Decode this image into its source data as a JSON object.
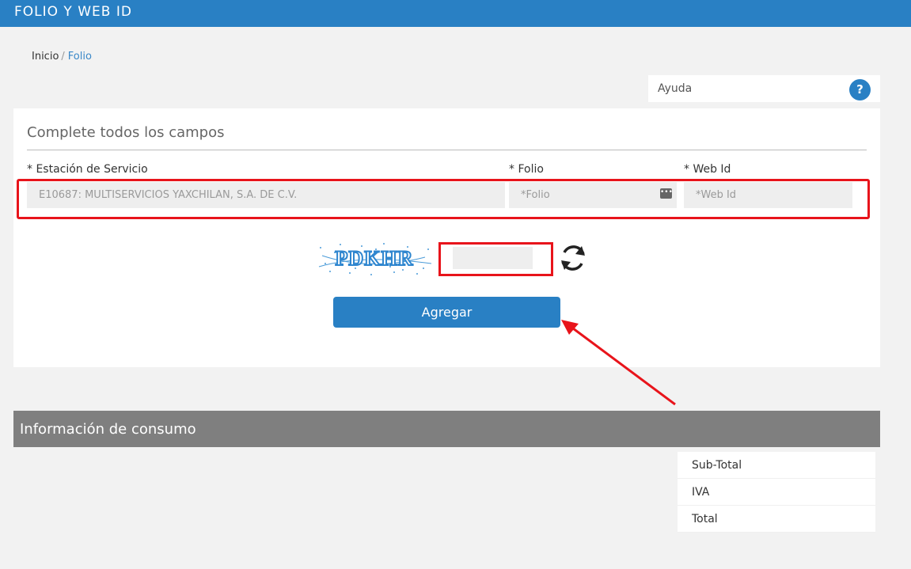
{
  "header": {
    "title": "FOLIO Y WEB ID",
    "bg_color": "#2980c4"
  },
  "breadcrumb": {
    "home": "Inicio",
    "separator": "/",
    "current": "Folio"
  },
  "help": {
    "label": "Ayuda",
    "icon": "?"
  },
  "form": {
    "heading": "Complete todos los campos",
    "station": {
      "label": "* Estación de Servicio",
      "value": "E10687: MULTISERVICIOS YAXCHILAN, S.A. DE C.V."
    },
    "folio": {
      "label": "* Folio",
      "placeholder": "*Folio"
    },
    "webid": {
      "label": "* Web Id",
      "placeholder": "*Web Id"
    },
    "captcha": {
      "text": "PDKHR",
      "icon": "refresh-icon"
    },
    "submit_label": "Agregar"
  },
  "consumption": {
    "title": "Información de consumo",
    "rows": [
      "Sub-Total",
      "IVA",
      "Total"
    ]
  },
  "colors": {
    "accent": "#2980c4",
    "highlight": "#e8141b",
    "section_bar": "#7f7f7f"
  }
}
